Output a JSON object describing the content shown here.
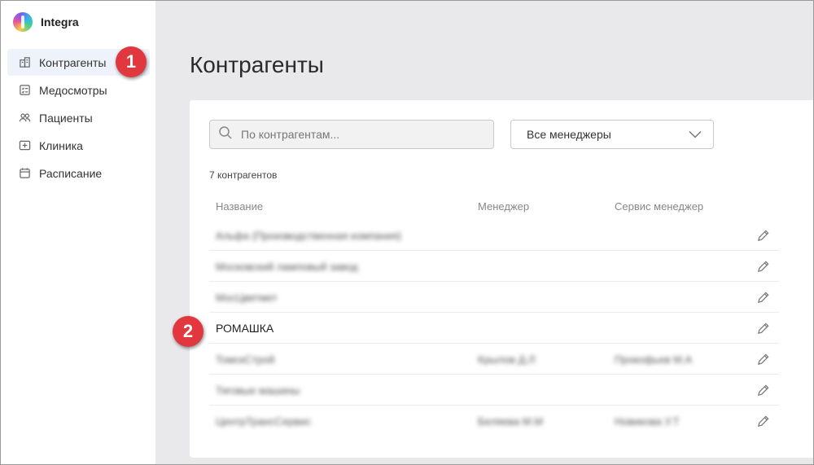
{
  "app": {
    "name": "Integra"
  },
  "sidebar": {
    "items": [
      {
        "label": "Контрагенты",
        "icon": "building-icon",
        "active": true
      },
      {
        "label": "Медосмотры",
        "icon": "checklist-icon",
        "active": false
      },
      {
        "label": "Пациенты",
        "icon": "users-icon",
        "active": false
      },
      {
        "label": "Клиника",
        "icon": "clinic-cross-icon",
        "active": false
      },
      {
        "label": "Расписание",
        "icon": "calendar-icon",
        "active": false
      }
    ]
  },
  "callouts": {
    "first": "1",
    "second": "2"
  },
  "main": {
    "title": "Контрагенты",
    "search_placeholder": "По контрагентам...",
    "manager_filter": "Все менеджеры",
    "count_label": "7 контрагентов",
    "columns": {
      "name": "Название",
      "manager": "Менеджер",
      "service_manager": "Сервис менеджер"
    },
    "rows": [
      {
        "name": "Альфа (Производственная компания)",
        "manager": "",
        "service_manager": "",
        "blurred": true
      },
      {
        "name": "Московский ламповый завод",
        "manager": "",
        "service_manager": "",
        "blurred": true
      },
      {
        "name": "МосЦветмет",
        "manager": "",
        "service_manager": "",
        "blurred": true
      },
      {
        "name": "РОМАШКА",
        "manager": "",
        "service_manager": "",
        "blurred": false
      },
      {
        "name": "ТомскСтрой",
        "manager": "Крылов Д.Л",
        "service_manager": "Прокофьев М.А",
        "blurred": true
      },
      {
        "name": "Тяговые машины",
        "manager": "",
        "service_manager": "",
        "blurred": true
      },
      {
        "name": "ЦентрТрансСервис",
        "manager": "Беляева М.М",
        "service_manager": "Новикова У.Т",
        "blurred": true
      }
    ]
  },
  "colors": {
    "accent_badge": "#e0383e",
    "active_nav": "#eef2fb",
    "background": "#e9e9eb"
  }
}
